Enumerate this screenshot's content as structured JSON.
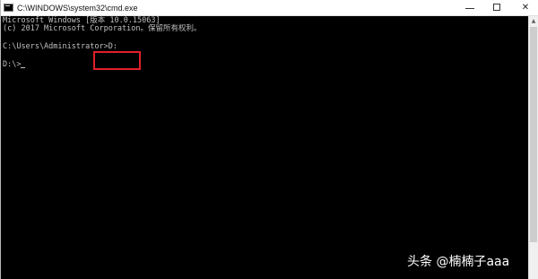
{
  "window": {
    "title": "C:\\WINDOWS\\system32\\cmd.exe",
    "icon": "cmd-icon",
    "controls": {
      "minimize_icon": "minimize-icon",
      "maximize_icon": "maximize-icon",
      "close_icon": "close-icon",
      "close_glyph": "✕"
    }
  },
  "console": {
    "lines": [
      "Microsoft Windows [版本 10.0.15063]",
      "(c) 2017 Microsoft Corporation。保留所有权利。",
      "C:\\Users\\Administrator>D:",
      "D:\\>"
    ],
    "text_color": "#c0c0c0",
    "background": "#000000"
  },
  "annotation": {
    "highlight_color": "#e0202a"
  },
  "watermark": {
    "text": "头条 @楠楠子aaa"
  }
}
